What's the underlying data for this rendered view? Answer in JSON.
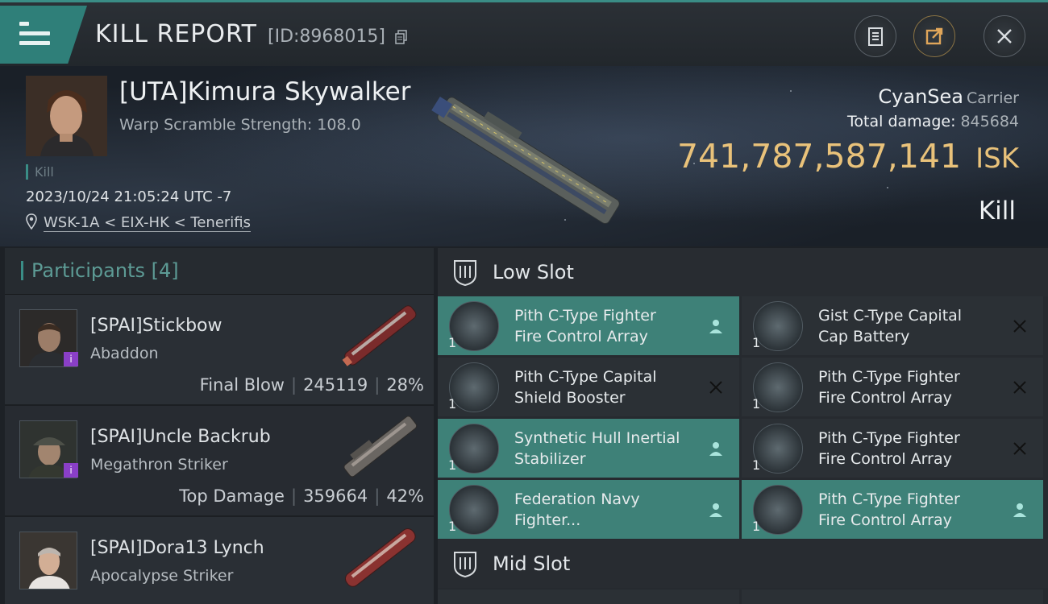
{
  "header": {
    "title": "KILL REPORT",
    "report_id": "[ID:8968015]",
    "icons": [
      "menu-icon",
      "copy-icon",
      "clipboard-icon",
      "share-icon",
      "close-icon"
    ],
    "accent_color": "#3a8d86"
  },
  "victim": {
    "name": "[UTA]Kimura Skywalker",
    "warp_scramble": "Warp Scramble Strength: 108.0",
    "kill_tag": "Kill",
    "datetime": "2023/10/24 21:05:24 UTC -7",
    "location": "WSK-1A < EIX-HK < Tenerifis",
    "ship_name": "CyanSea",
    "ship_class": "Carrier",
    "total_damage_label": "Total damage:",
    "total_damage_value": "845684",
    "isk_value": "741,787,587,141",
    "isk_unit": "ISK",
    "result": "Kill",
    "isk_color": "#e9c27a"
  },
  "participants": {
    "title": "Participants",
    "count": "[4]",
    "list": [
      {
        "name": "[SPAI]Stickbow",
        "ship": "Abaddon",
        "role": "Final Blow",
        "damage": "245119",
        "percent": "28%",
        "badge": "i"
      },
      {
        "name": "[SPAI]Uncle Backrub",
        "ship": "Megathron Striker",
        "role": "Top Damage",
        "damage": "359664",
        "percent": "42%",
        "badge": "i"
      },
      {
        "name": "[SPAI]Dora13 Lynch",
        "ship": "Apocalypse Striker"
      }
    ]
  },
  "slots": {
    "low": {
      "label": "Low Slot",
      "modules": [
        {
          "line1": "Pith C-Type Fighter",
          "line2": "Fire Control Array",
          "qty": "1",
          "status": "person-icon"
        },
        {
          "line1": "Gist C-Type Capital",
          "line2": "Cap Battery",
          "qty": "1",
          "status": "x-icon"
        },
        {
          "line1": "Pith C-Type Capital",
          "line2": "Shield Booster",
          "qty": "1",
          "status": "x-icon"
        },
        {
          "line1": "Pith C-Type Fighter",
          "line2": "Fire Control Array",
          "qty": "1",
          "status": "x-icon"
        },
        {
          "line1": "Synthetic Hull Inertial",
          "line2": "Stabilizer",
          "qty": "1",
          "status": "person-icon"
        },
        {
          "line1": "Pith C-Type Fighter",
          "line2": "Fire Control Array",
          "qty": "1",
          "status": "x-icon"
        },
        {
          "line1": "Federation Navy",
          "line2": "Fighter...",
          "qty": "1",
          "status": "person-icon"
        },
        {
          "line1": "Pith C-Type Fighter",
          "line2": "Fire Control Array",
          "qty": "1",
          "status": "person-icon"
        }
      ]
    },
    "mid": {
      "label": "Mid Slot"
    }
  }
}
